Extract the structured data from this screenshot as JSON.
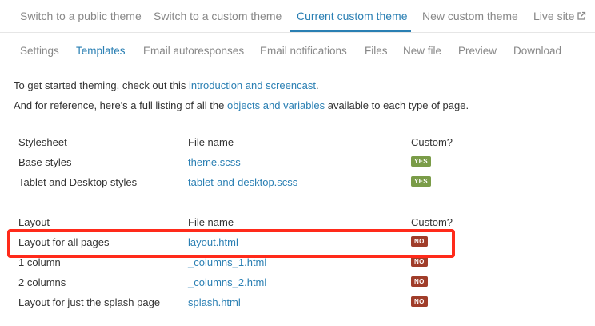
{
  "top_tabs": [
    {
      "label": "Switch to a public theme"
    },
    {
      "label": "Switch to a custom theme"
    },
    {
      "label": "Current custom theme"
    },
    {
      "label": "New custom theme"
    },
    {
      "label": "Live site"
    }
  ],
  "sub_tabs": [
    "Settings",
    "Templates",
    "Email autoresponses",
    "Email notifications",
    "Files",
    "New file",
    "Preview",
    "Download"
  ],
  "intro": {
    "line1_prefix": "To get started theming, check out this ",
    "line1_link": "introduction and screencast",
    "line1_suffix": ".",
    "line2_prefix": "And for reference, here's a full listing of all the ",
    "line2_link": "objects and variables",
    "line2_suffix": " available to each type of page."
  },
  "stylesheet_table": {
    "headers": [
      "Stylesheet",
      "File name",
      "Custom?"
    ],
    "rows": [
      {
        "name": "Base styles",
        "file": "theme.scss",
        "custom": "YES"
      },
      {
        "name": "Tablet and Desktop styles",
        "file": "tablet-and-desktop.scss",
        "custom": "YES"
      }
    ]
  },
  "layout_table": {
    "headers": [
      "Layout",
      "File name",
      "Custom?"
    ],
    "rows": [
      {
        "name": "Layout for all pages",
        "file": "layout.html",
        "custom": "NO"
      },
      {
        "name": "1 column",
        "file": "_columns_1.html",
        "custom": "NO"
      },
      {
        "name": "2 columns",
        "file": "_columns_2.html",
        "custom": "NO"
      },
      {
        "name": "Layout for just the splash page",
        "file": "splash.html",
        "custom": "NO"
      }
    ]
  },
  "icons": {
    "live_site": "external-link-icon"
  },
  "colors": {
    "accent": "#2a7fb3",
    "yes_badge": "#7a9c48",
    "no_badge": "#a03d2a",
    "highlight": "#ff2a1a"
  }
}
